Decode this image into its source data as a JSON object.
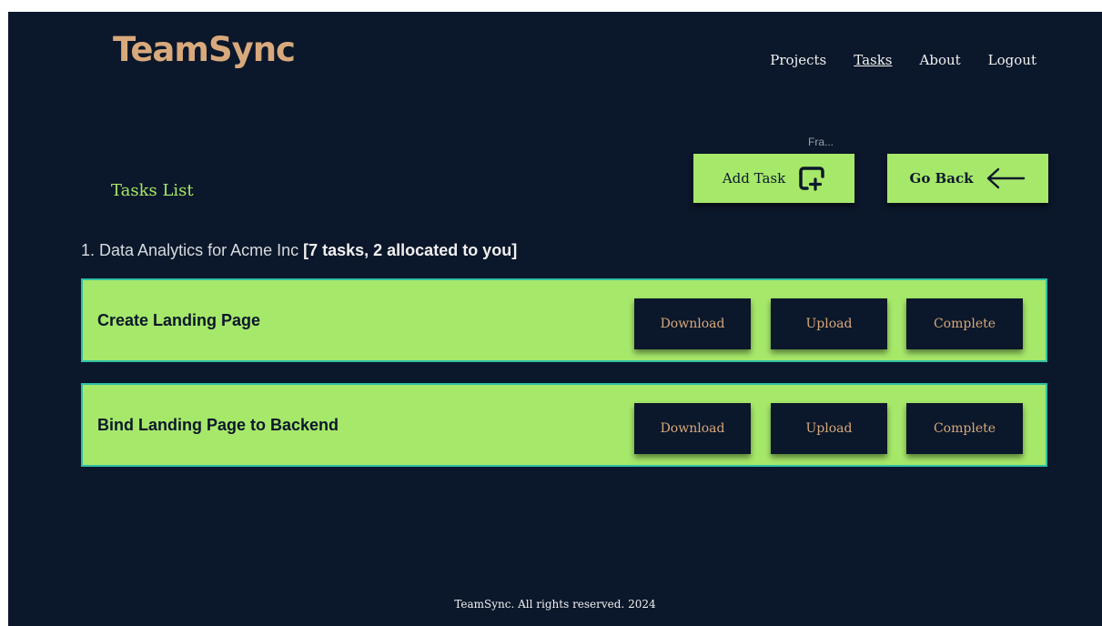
{
  "brand": {
    "name": "TeamSync"
  },
  "nav": {
    "items": [
      {
        "label": "Projects",
        "active": false
      },
      {
        "label": "Tasks",
        "active": true
      },
      {
        "label": "About",
        "active": false
      },
      {
        "label": "Logout",
        "active": false
      }
    ]
  },
  "page": {
    "heading": "Tasks List"
  },
  "tooltip": {
    "text": "Fra..."
  },
  "actions": {
    "add_task_label": "Add Task",
    "add_task_icon": "add-square-icon",
    "go_back_label": "Go Back",
    "go_back_icon": "arrow-left-icon"
  },
  "project": {
    "prefix": "1. Data Analytics for Acme Inc ",
    "summary": "[7 tasks, 2 allocated to you]"
  },
  "tasks": [
    {
      "title": "Create Landing Page",
      "download_label": "Download",
      "upload_label": "Upload",
      "complete_label": "Complete"
    },
    {
      "title": "Bind Landing Page to Backend",
      "download_label": "Download",
      "upload_label": "Upload",
      "complete_label": "Complete"
    }
  ],
  "footer": {
    "text": "TeamSync. All rights reserved. 2024"
  },
  "colors": {
    "background": "#0b172a",
    "accent_green": "#a6e86a",
    "brand_tan": "#d8a97c",
    "card_border": "#2fbfa4"
  }
}
